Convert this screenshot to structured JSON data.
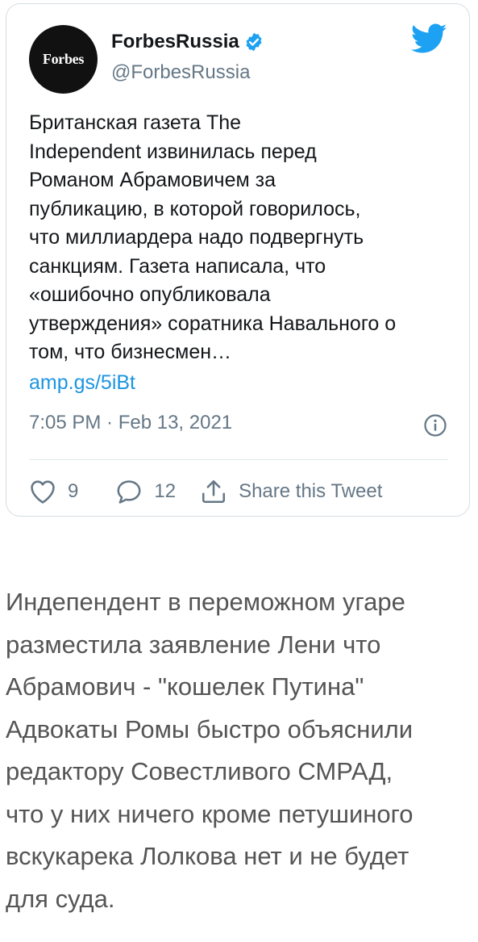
{
  "tweet": {
    "avatar_text": "Forbes",
    "display_name": "ForbesRussia",
    "handle": "@ForbesRussia",
    "body": "Британская газета The\nIndependent извинилась перед\nРоманом Абрамовичем за\nпубликацию, в которой говорилось,\nчто миллиардера надо подвергнуть\nсанкциям. Газета написала, что\n«ошибочно опубликовала\nутверждения» соратника Навального о\nтом, что бизнесмен…",
    "link": "amp.gs/5iBt",
    "timestamp": "7:05 PM · Feb 13, 2021",
    "likes": "9",
    "replies": "12",
    "share_label": "Share this Tweet",
    "accent_color": "#1da1f2"
  },
  "comment": {
    "text": "Индепендент в переможном угаре\nразместила заявление Лени что\nАбрамович - \"кошелек Путина\"\nАдвокаты Ромы быстро объяснили\nредактору Совестливого СМРАД,\nчто у них ничего кроме петушиного\nвскукарека Лолкова нет и не будет\nдля суда."
  }
}
